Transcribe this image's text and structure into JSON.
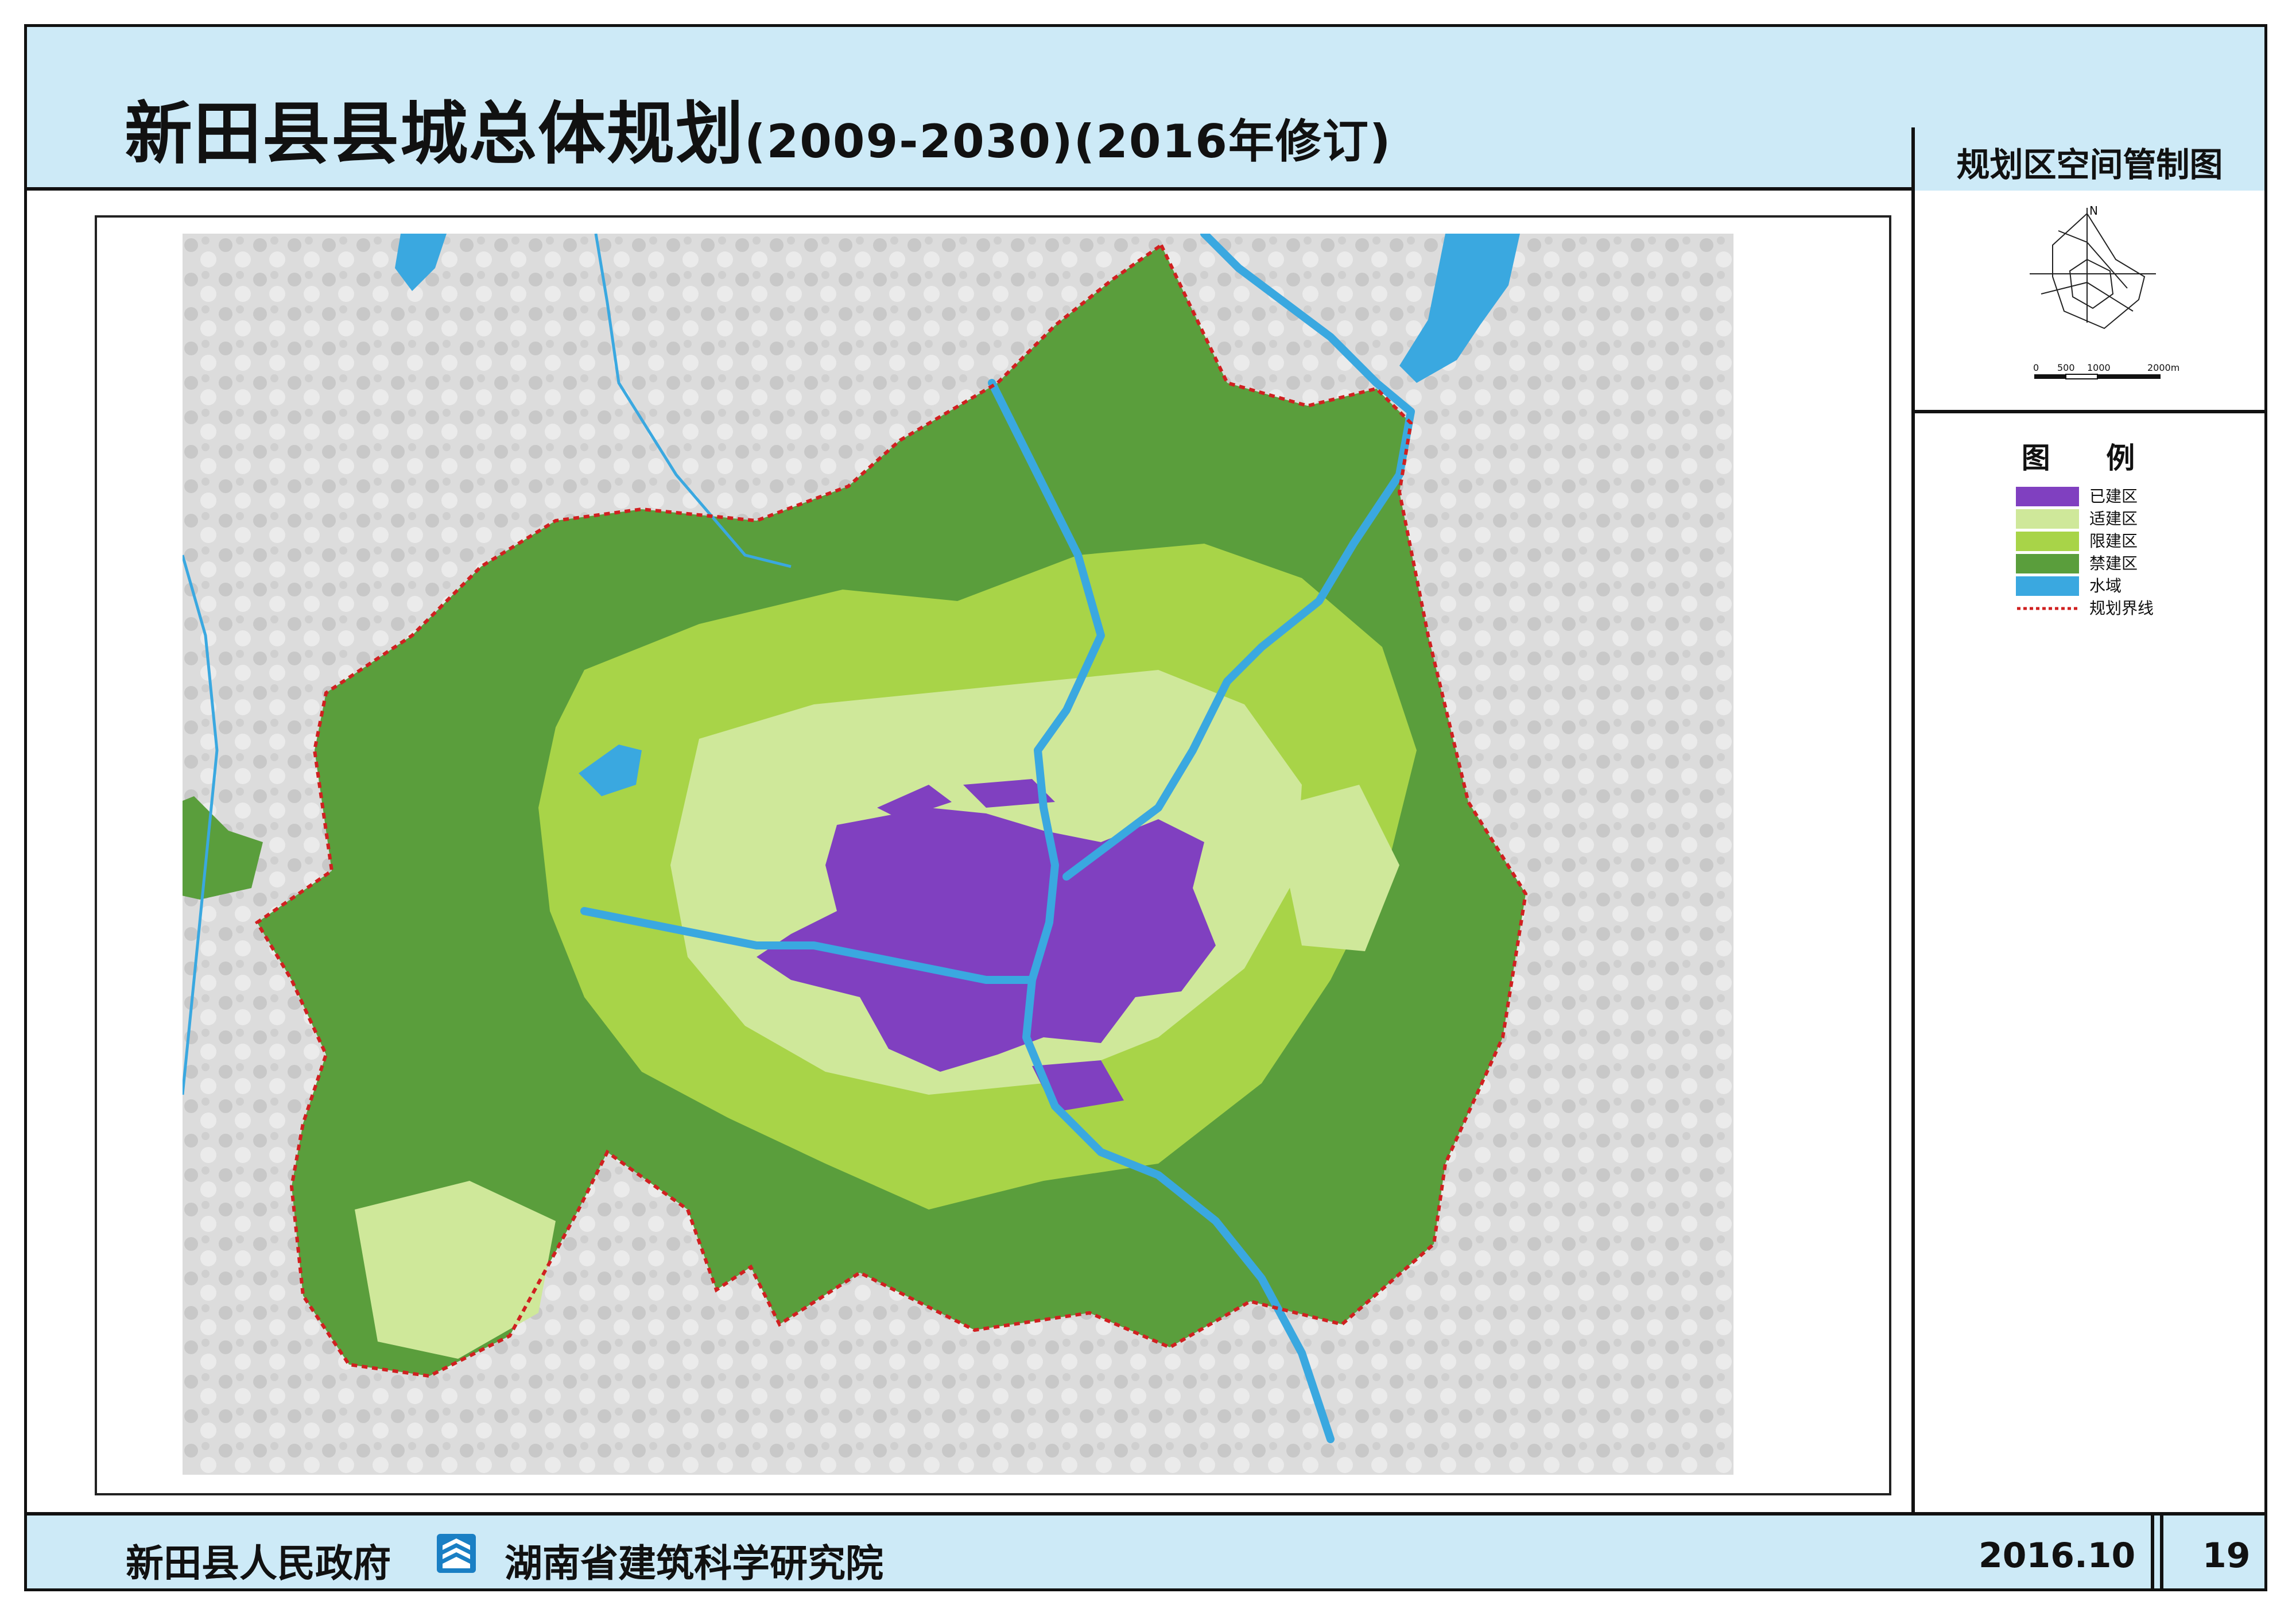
{
  "header": {
    "title_main": "新田县县城总体规划",
    "title_years": "(2009-2030)(2016年修订)"
  },
  "map_name": "规划区空间管制图",
  "scale_bar": {
    "labels": [
      "0",
      "500",
      "1000",
      "2000m"
    ],
    "north_label": "N"
  },
  "legend": {
    "title": "图 例",
    "items": [
      {
        "label": "已建区",
        "color": "#8040c0"
      },
      {
        "label": "适建区",
        "color": "#cfe89a"
      },
      {
        "label": "限建区",
        "color": "#a8d448"
      },
      {
        "label": "禁建区",
        "color": "#5a9e3c"
      },
      {
        "label": "水域",
        "color": "#3aa8e0"
      },
      {
        "label": "规划界线",
        "color": "#d02020"
      }
    ]
  },
  "footer": {
    "gov": "新田县人民政府",
    "institute": "湖南省建筑科学研究院",
    "date": "2016.10",
    "page": "19"
  }
}
